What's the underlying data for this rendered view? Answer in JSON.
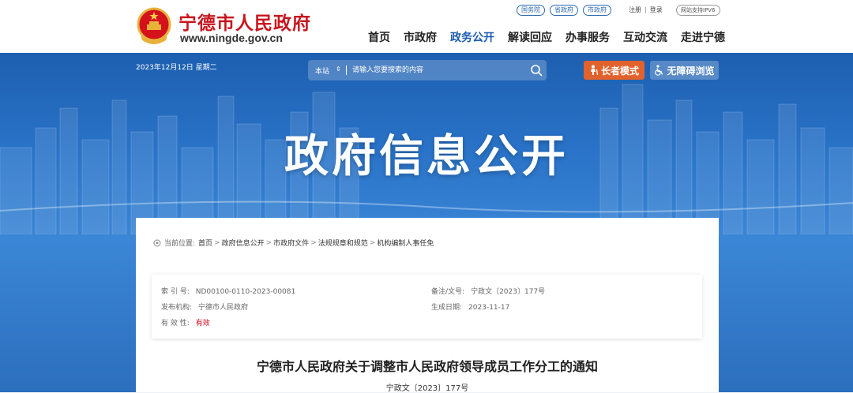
{
  "header": {
    "site_name": "宁德市人民政府",
    "site_url": "www.ningde.gov.cn",
    "ext_links": [
      "国务院",
      "省政府",
      "市政府"
    ],
    "register": "注册",
    "login": "登录",
    "ipv6": "网站支持IPV6",
    "nav": [
      "首页",
      "市政府",
      "政务公开",
      "解读回应",
      "办事服务",
      "互动交流",
      "走进宁德"
    ],
    "active_nav": "政务公开"
  },
  "banner": {
    "date": "2023年12月12日  星期二",
    "search": {
      "scope": "本站",
      "placeholder": "请输入您要搜索的内容"
    },
    "elder_mode": "长者模式",
    "accessible": "无障碍浏览",
    "title": "政府信息公开"
  },
  "breadcrumb": {
    "prefix": "当前位置:",
    "items": [
      "首页",
      "政府信息公开",
      "市政府文件",
      "法规规章和规范",
      "机构编制人事任免"
    ]
  },
  "meta": {
    "index_label": "索  引  号:",
    "index_value": "ND00100-0110-2023-00081",
    "doc_no_label": "备注/文号:",
    "doc_no_value": "宁政文〔2023〕177号",
    "publisher_label": "发布机构:",
    "publisher_value": "宁德市人民政府",
    "date_label": "生成日期:",
    "date_value": "2023-11-17",
    "validity_label": "有  效  性:",
    "validity_value": "有效"
  },
  "document": {
    "title": "宁德市人民政府关于调整市人民政府领导成员工作分工的通知",
    "number": "宁政文〔2023〕177号"
  },
  "colors": {
    "brand_red": "#c9151e",
    "nav_active": "#1c5bb0",
    "elder_orange": "#e2622d",
    "valid_red": "#d0021b"
  }
}
